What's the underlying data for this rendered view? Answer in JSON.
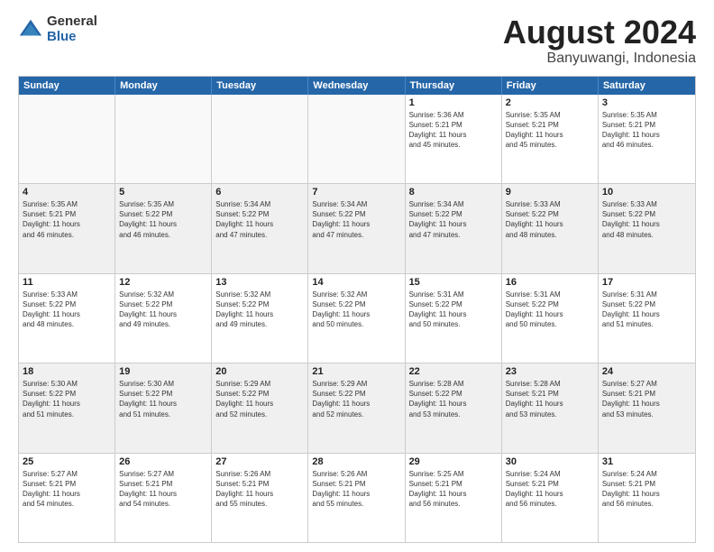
{
  "logo": {
    "general": "General",
    "blue": "Blue"
  },
  "header": {
    "title": "August 2024",
    "location": "Banyuwangi, Indonesia"
  },
  "days": [
    "Sunday",
    "Monday",
    "Tuesday",
    "Wednesday",
    "Thursday",
    "Friday",
    "Saturday"
  ],
  "weeks": [
    [
      {
        "day": "",
        "detail": ""
      },
      {
        "day": "",
        "detail": ""
      },
      {
        "day": "",
        "detail": ""
      },
      {
        "day": "",
        "detail": ""
      },
      {
        "day": "1",
        "detail": "Sunrise: 5:36 AM\nSunset: 5:21 PM\nDaylight: 11 hours\nand 45 minutes."
      },
      {
        "day": "2",
        "detail": "Sunrise: 5:35 AM\nSunset: 5:21 PM\nDaylight: 11 hours\nand 45 minutes."
      },
      {
        "day": "3",
        "detail": "Sunrise: 5:35 AM\nSunset: 5:21 PM\nDaylight: 11 hours\nand 46 minutes."
      }
    ],
    [
      {
        "day": "4",
        "detail": "Sunrise: 5:35 AM\nSunset: 5:21 PM\nDaylight: 11 hours\nand 46 minutes."
      },
      {
        "day": "5",
        "detail": "Sunrise: 5:35 AM\nSunset: 5:22 PM\nDaylight: 11 hours\nand 46 minutes."
      },
      {
        "day": "6",
        "detail": "Sunrise: 5:34 AM\nSunset: 5:22 PM\nDaylight: 11 hours\nand 47 minutes."
      },
      {
        "day": "7",
        "detail": "Sunrise: 5:34 AM\nSunset: 5:22 PM\nDaylight: 11 hours\nand 47 minutes."
      },
      {
        "day": "8",
        "detail": "Sunrise: 5:34 AM\nSunset: 5:22 PM\nDaylight: 11 hours\nand 47 minutes."
      },
      {
        "day": "9",
        "detail": "Sunrise: 5:33 AM\nSunset: 5:22 PM\nDaylight: 11 hours\nand 48 minutes."
      },
      {
        "day": "10",
        "detail": "Sunrise: 5:33 AM\nSunset: 5:22 PM\nDaylight: 11 hours\nand 48 minutes."
      }
    ],
    [
      {
        "day": "11",
        "detail": "Sunrise: 5:33 AM\nSunset: 5:22 PM\nDaylight: 11 hours\nand 48 minutes."
      },
      {
        "day": "12",
        "detail": "Sunrise: 5:32 AM\nSunset: 5:22 PM\nDaylight: 11 hours\nand 49 minutes."
      },
      {
        "day": "13",
        "detail": "Sunrise: 5:32 AM\nSunset: 5:22 PM\nDaylight: 11 hours\nand 49 minutes."
      },
      {
        "day": "14",
        "detail": "Sunrise: 5:32 AM\nSunset: 5:22 PM\nDaylight: 11 hours\nand 50 minutes."
      },
      {
        "day": "15",
        "detail": "Sunrise: 5:31 AM\nSunset: 5:22 PM\nDaylight: 11 hours\nand 50 minutes."
      },
      {
        "day": "16",
        "detail": "Sunrise: 5:31 AM\nSunset: 5:22 PM\nDaylight: 11 hours\nand 50 minutes."
      },
      {
        "day": "17",
        "detail": "Sunrise: 5:31 AM\nSunset: 5:22 PM\nDaylight: 11 hours\nand 51 minutes."
      }
    ],
    [
      {
        "day": "18",
        "detail": "Sunrise: 5:30 AM\nSunset: 5:22 PM\nDaylight: 11 hours\nand 51 minutes."
      },
      {
        "day": "19",
        "detail": "Sunrise: 5:30 AM\nSunset: 5:22 PM\nDaylight: 11 hours\nand 51 minutes."
      },
      {
        "day": "20",
        "detail": "Sunrise: 5:29 AM\nSunset: 5:22 PM\nDaylight: 11 hours\nand 52 minutes."
      },
      {
        "day": "21",
        "detail": "Sunrise: 5:29 AM\nSunset: 5:22 PM\nDaylight: 11 hours\nand 52 minutes."
      },
      {
        "day": "22",
        "detail": "Sunrise: 5:28 AM\nSunset: 5:22 PM\nDaylight: 11 hours\nand 53 minutes."
      },
      {
        "day": "23",
        "detail": "Sunrise: 5:28 AM\nSunset: 5:21 PM\nDaylight: 11 hours\nand 53 minutes."
      },
      {
        "day": "24",
        "detail": "Sunrise: 5:27 AM\nSunset: 5:21 PM\nDaylight: 11 hours\nand 53 minutes."
      }
    ],
    [
      {
        "day": "25",
        "detail": "Sunrise: 5:27 AM\nSunset: 5:21 PM\nDaylight: 11 hours\nand 54 minutes."
      },
      {
        "day": "26",
        "detail": "Sunrise: 5:27 AM\nSunset: 5:21 PM\nDaylight: 11 hours\nand 54 minutes."
      },
      {
        "day": "27",
        "detail": "Sunrise: 5:26 AM\nSunset: 5:21 PM\nDaylight: 11 hours\nand 55 minutes."
      },
      {
        "day": "28",
        "detail": "Sunrise: 5:26 AM\nSunset: 5:21 PM\nDaylight: 11 hours\nand 55 minutes."
      },
      {
        "day": "29",
        "detail": "Sunrise: 5:25 AM\nSunset: 5:21 PM\nDaylight: 11 hours\nand 56 minutes."
      },
      {
        "day": "30",
        "detail": "Sunrise: 5:24 AM\nSunset: 5:21 PM\nDaylight: 11 hours\nand 56 minutes."
      },
      {
        "day": "31",
        "detail": "Sunrise: 5:24 AM\nSunset: 5:21 PM\nDaylight: 11 hours\nand 56 minutes."
      }
    ]
  ]
}
